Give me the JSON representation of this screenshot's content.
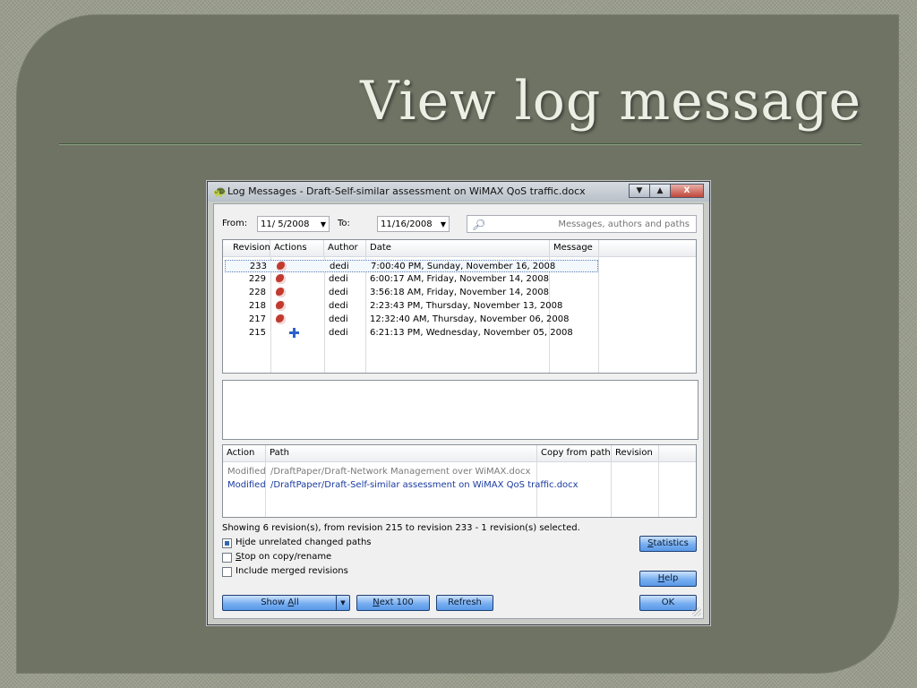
{
  "slide": {
    "title": "View log message"
  },
  "window": {
    "title": "Log Messages - Draft-Self-similar assessment on WiMAX QoS traffic.docx",
    "controls": {
      "minimize": "▼",
      "maximize": "▲",
      "close": "X"
    }
  },
  "filter": {
    "from_label": "From:",
    "from_value": "11/ 5/2008",
    "to_label": "To:",
    "to_value": "11/16/2008",
    "search_placeholder": "Messages, authors and paths"
  },
  "revisions": {
    "columns": [
      "Revision",
      "Actions",
      "Author",
      "Date",
      "Message"
    ],
    "rows": [
      {
        "revision": "233",
        "action": "modified",
        "author": "dedi",
        "date": "7:00:40 PM, Sunday, November 16, 2008",
        "message": ""
      },
      {
        "revision": "229",
        "action": "modified",
        "author": "dedi",
        "date": "6:00:17 AM, Friday, November 14, 2008",
        "message": ""
      },
      {
        "revision": "228",
        "action": "modified",
        "author": "dedi",
        "date": "3:56:18 AM, Friday, November 14, 2008",
        "message": ""
      },
      {
        "revision": "218",
        "action": "modified",
        "author": "dedi",
        "date": "2:23:43 PM, Thursday, November 13, 2008",
        "message": ""
      },
      {
        "revision": "217",
        "action": "modified",
        "author": "dedi",
        "date": "12:32:40 AM, Thursday, November 06, 2008",
        "message": ""
      },
      {
        "revision": "215",
        "action": "added",
        "author": "dedi",
        "date": "6:21:13 PM, Wednesday, November 05, 2008",
        "message": ""
      }
    ],
    "selected_index": 0
  },
  "paths": {
    "columns": [
      "Action",
      "Path",
      "Copy from path",
      "Revision"
    ],
    "rows": [
      {
        "action": "Modified",
        "path": "/DraftPaper/Draft-Network Management over WiMAX.docx",
        "color": "#7a7a7a"
      },
      {
        "action": "Modified",
        "path": "/DraftPaper/Draft-Self-similar assessment on WiMAX QoS traffic.docx",
        "color": "#1a3aa0"
      }
    ]
  },
  "status": {
    "text": "Showing 6 revision(s), from revision 215 to revision 233 - 1 revision(s) selected."
  },
  "options": {
    "hide_unrelated": {
      "pre": "H",
      "u": "i",
      "post": "de unrelated changed paths",
      "checked": true
    },
    "stop_on_copy": {
      "pre": "",
      "u": "S",
      "post": "top on copy/rename",
      "checked": false
    },
    "include_merged": {
      "pre": "Include merged revisions",
      "u": "",
      "post": "",
      "checked": false
    }
  },
  "buttons": {
    "statistics": {
      "pre": "",
      "u": "S",
      "post": "tatistics"
    },
    "help": {
      "pre": "",
      "u": "H",
      "post": "elp"
    },
    "show_all": {
      "pre": "Show ",
      "u": "A",
      "post": "ll"
    },
    "next_100": {
      "pre": "",
      "u": "N",
      "post": "ext 100"
    },
    "refresh": {
      "pre": "Refresh",
      "u": "",
      "post": ""
    },
    "ok": {
      "pre": "OK",
      "u": "",
      "post": ""
    }
  },
  "colors": {
    "panel": "#6e7364",
    "title_text": "#ecefe4",
    "button_blue": "#77aef0",
    "path_blue": "#1a3aa0"
  },
  "icons": {
    "app": "tortoise-icon",
    "search": "magnifier-icon",
    "modified": "modified-action-icon",
    "added": "added-action-icon"
  }
}
